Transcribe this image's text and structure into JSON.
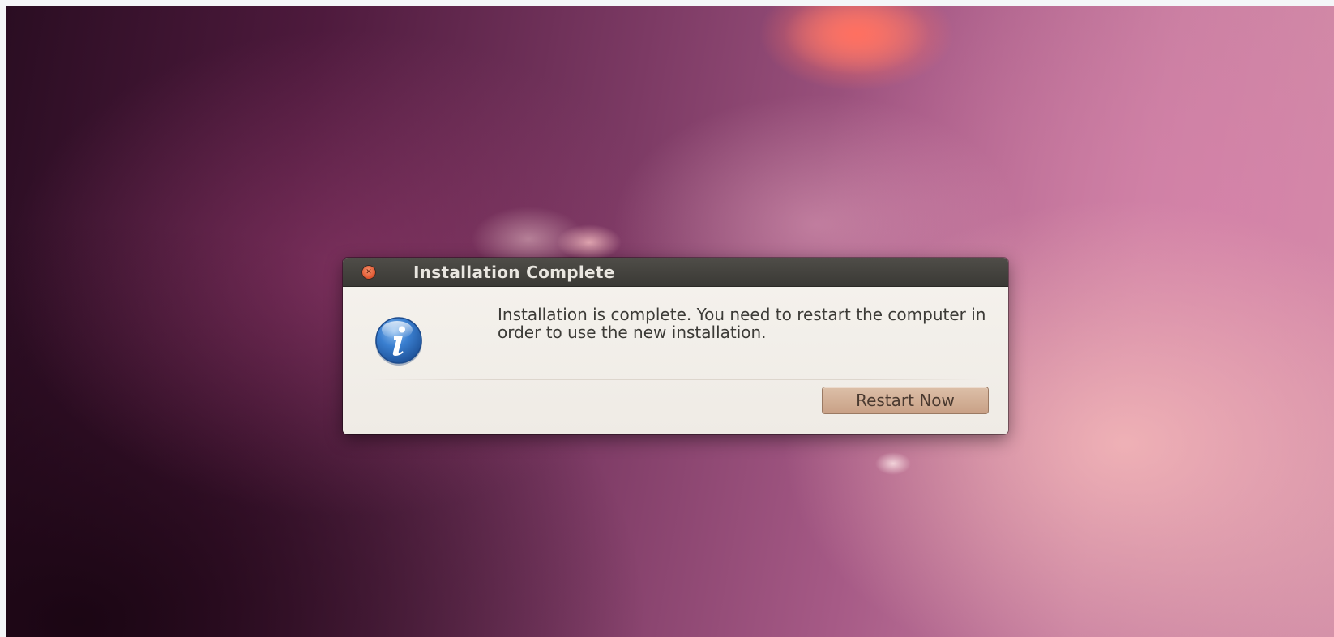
{
  "dialog": {
    "title": "Installation Complete",
    "close_icon": "close-icon",
    "info_icon": "info-icon",
    "message": "Installation is complete. You need to restart the computer in order to use the new installation.",
    "restart_label": "Restart Now"
  },
  "colors": {
    "titlebar": "#3e3d39",
    "title_text": "#e9e6e0",
    "dialog_body": "#f1ece6",
    "button": "#cfa98d",
    "close_button": "#e0552f",
    "info_icon_blue": "#2f6fbd"
  }
}
